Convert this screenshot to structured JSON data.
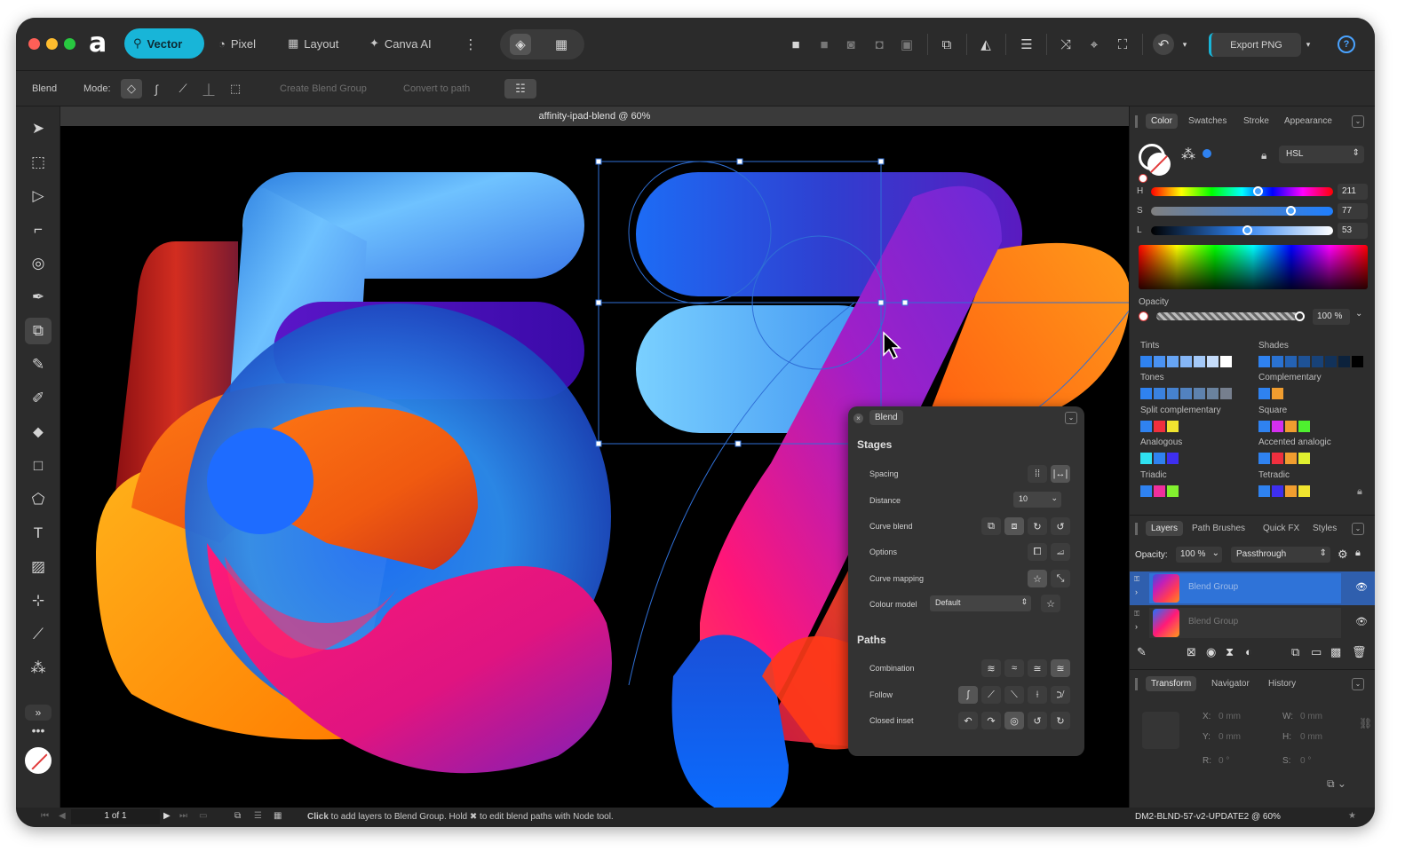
{
  "personas": [
    {
      "label": "Vector",
      "active": true
    },
    {
      "label": "Pixel",
      "active": false
    },
    {
      "label": "Layout",
      "active": false
    },
    {
      "label": "Canva AI",
      "active": false
    }
  ],
  "toolbar": {
    "export_label": "Export PNG"
  },
  "context": {
    "tool_label": "Blend",
    "mode_label": "Mode:",
    "create_blend_group": "Create Blend Group",
    "convert_to_path": "Convert to path"
  },
  "document": {
    "tab_title": "affinity-ipad-blend @ 60%"
  },
  "status": {
    "page": "1 of 1",
    "hint_bold": "Click",
    "hint_text": " to add layers to Blend Group. Hold ",
    "hint_key": "✖",
    "hint_text2": " to edit blend paths with Node tool."
  },
  "color_panel": {
    "tabs": [
      "Color",
      "Swatches",
      "Stroke",
      "Appearance"
    ],
    "model": "HSL",
    "h_label": "H",
    "h_value": "211",
    "h_fraction": 0.59,
    "s_label": "S",
    "s_value": "77",
    "s_fraction": 0.77,
    "l_label": "L",
    "l_value": "53",
    "l_fraction": 0.53,
    "opacity_label": "Opacity",
    "opacity_value": "100 %",
    "groups": [
      "Tints",
      "Shades",
      "Tones",
      "Complementary",
      "Split complementary",
      "Square",
      "Analogous",
      "Accented analogic",
      "Triadic",
      "Tetradic"
    ]
  },
  "layers_panel": {
    "tabs": [
      "Layers",
      "Path Brushes",
      "Quick FX",
      "Styles"
    ],
    "opacity_label": "Opacity:",
    "opacity_value": "100 %",
    "blend_mode": "Passthrough",
    "items": [
      {
        "name": "Blend Group",
        "selected": true
      },
      {
        "name": "Blend Group",
        "selected": false
      }
    ]
  },
  "transform_panel": {
    "tabs": [
      "Transform",
      "Navigator",
      "History"
    ],
    "x_label": "X:",
    "x_value": "0 mm",
    "y_label": "Y:",
    "y_value": "0 mm",
    "w_label": "W:",
    "w_value": "0 mm",
    "h_label": "H:",
    "h_value": "0 mm",
    "r_label": "R:",
    "r_value": "0 °",
    "s_label": "S:",
    "s_value": "0 °",
    "footer": "DM2-BLND-57-v2-UPDATE2 @ 60%"
  },
  "blend_panel": {
    "title": "Blend",
    "stages_heading": "Stages",
    "spacing_label": "Spacing",
    "distance_label": "Distance",
    "distance_value": "10",
    "curve_blend_label": "Curve blend",
    "options_label": "Options",
    "curve_mapping_label": "Curve mapping",
    "colour_model_label": "Colour model",
    "colour_model_value": "Default",
    "paths_heading": "Paths",
    "combination_label": "Combination",
    "follow_label": "Follow",
    "closed_inset_label": "Closed inset"
  },
  "colors": {
    "accent": "#18b5d8",
    "canvas": "#000000",
    "selection_blue": "#2f6fd6"
  }
}
